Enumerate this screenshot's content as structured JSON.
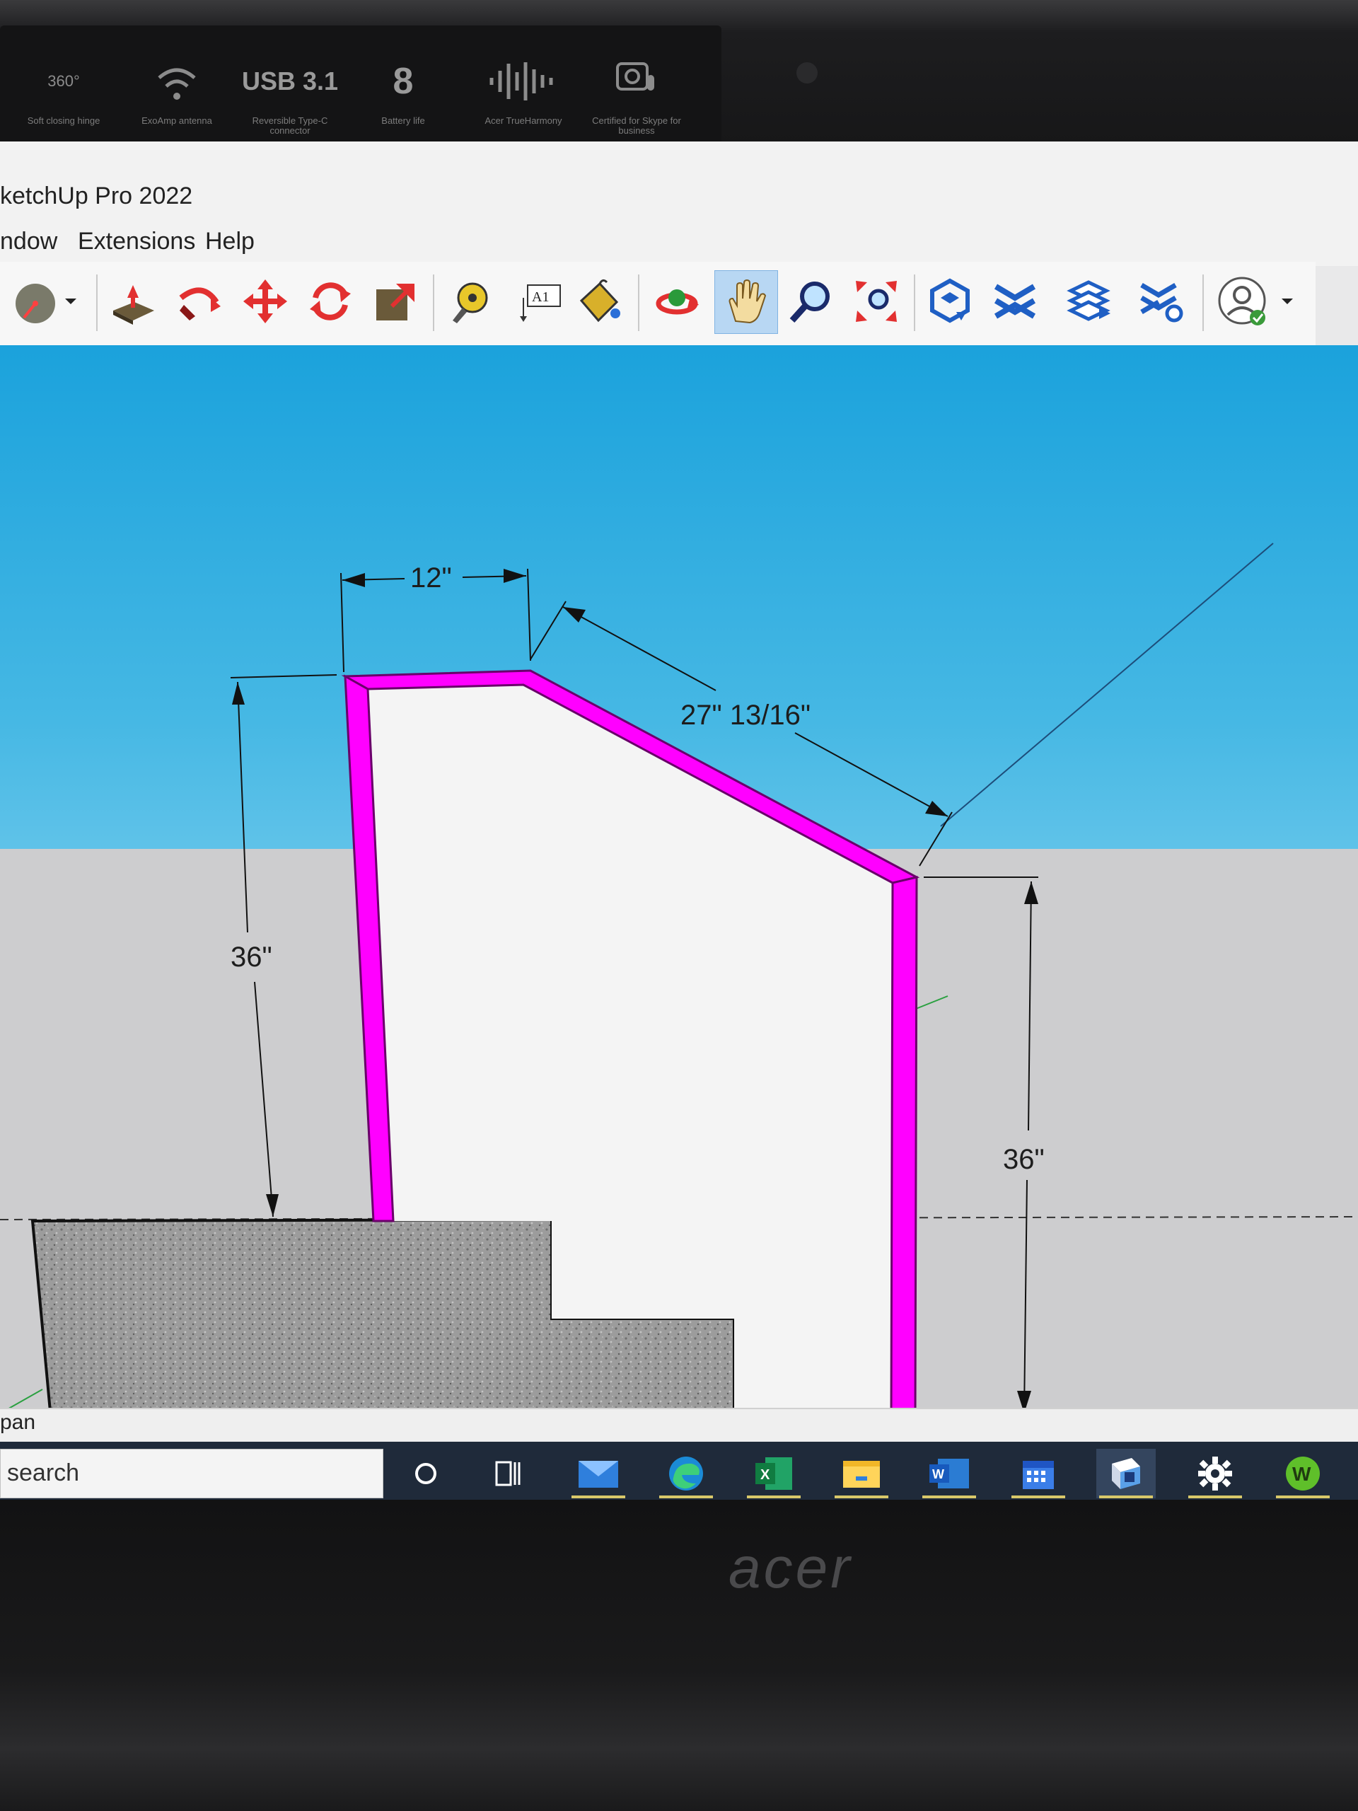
{
  "laptop": {
    "features": [
      {
        "icon": "hinge-360-icon",
        "big": "360°",
        "caption": "Soft closing hinge"
      },
      {
        "icon": "wifi-icon",
        "big": "",
        "caption": "ExoAmp antenna"
      },
      {
        "icon": "usb-icon",
        "big": "USB 3.1",
        "caption": "Reversible Type-C connector"
      },
      {
        "icon": "battery-icon",
        "big": "8",
        "caption": "Battery life"
      },
      {
        "icon": "audio-wave-icon",
        "big": "",
        "caption": "Acer TrueHarmony"
      },
      {
        "icon": "skype-cert-icon",
        "big": "",
        "caption": "Certified for Skype for business"
      }
    ],
    "brand": "acer"
  },
  "app": {
    "title": "ketchUp Pro 2022",
    "menu": [
      "ndow",
      "Extensions",
      "Help"
    ],
    "toolbar": [
      "select-icon",
      "push-pull-icon",
      "follow-me-icon",
      "move-icon",
      "rotate-icon",
      "scale-icon",
      "tape-measure-icon",
      "text-label-icon",
      "paint-bucket-icon",
      "orbit-icon",
      "pan-icon",
      "zoom-icon",
      "zoom-extents-icon",
      "3d-warehouse-icon",
      "extension-warehouse-icon",
      "layout-icon",
      "extension-manager-icon",
      "user-account-icon"
    ],
    "active_tool": "pan-icon",
    "text_tool_glyph": "A1"
  },
  "model": {
    "dimensions": {
      "top_width": "12\"",
      "slope_length": "27\" 13/16\"",
      "left_height": "36\"",
      "right_height": "36\""
    },
    "colors": {
      "wall": "#ff00ff",
      "panel": "#f4f4f4",
      "concrete": "#9a9a9a",
      "sky": "#1ba2dc",
      "ground": "#cdcdcf"
    }
  },
  "status": {
    "text": "pan"
  },
  "taskbar": {
    "search_placeholder": "search",
    "apps": [
      "cortana-icon",
      "task-view-icon",
      "mail-icon",
      "edge-icon",
      "excel-icon",
      "file-explorer-icon",
      "word-icon",
      "calendar-icon",
      "sketchup-icon",
      "settings-icon",
      "w-app-icon"
    ],
    "excel_glyph": "X",
    "word_glyph": "W",
    "w_app_glyph": "W"
  }
}
